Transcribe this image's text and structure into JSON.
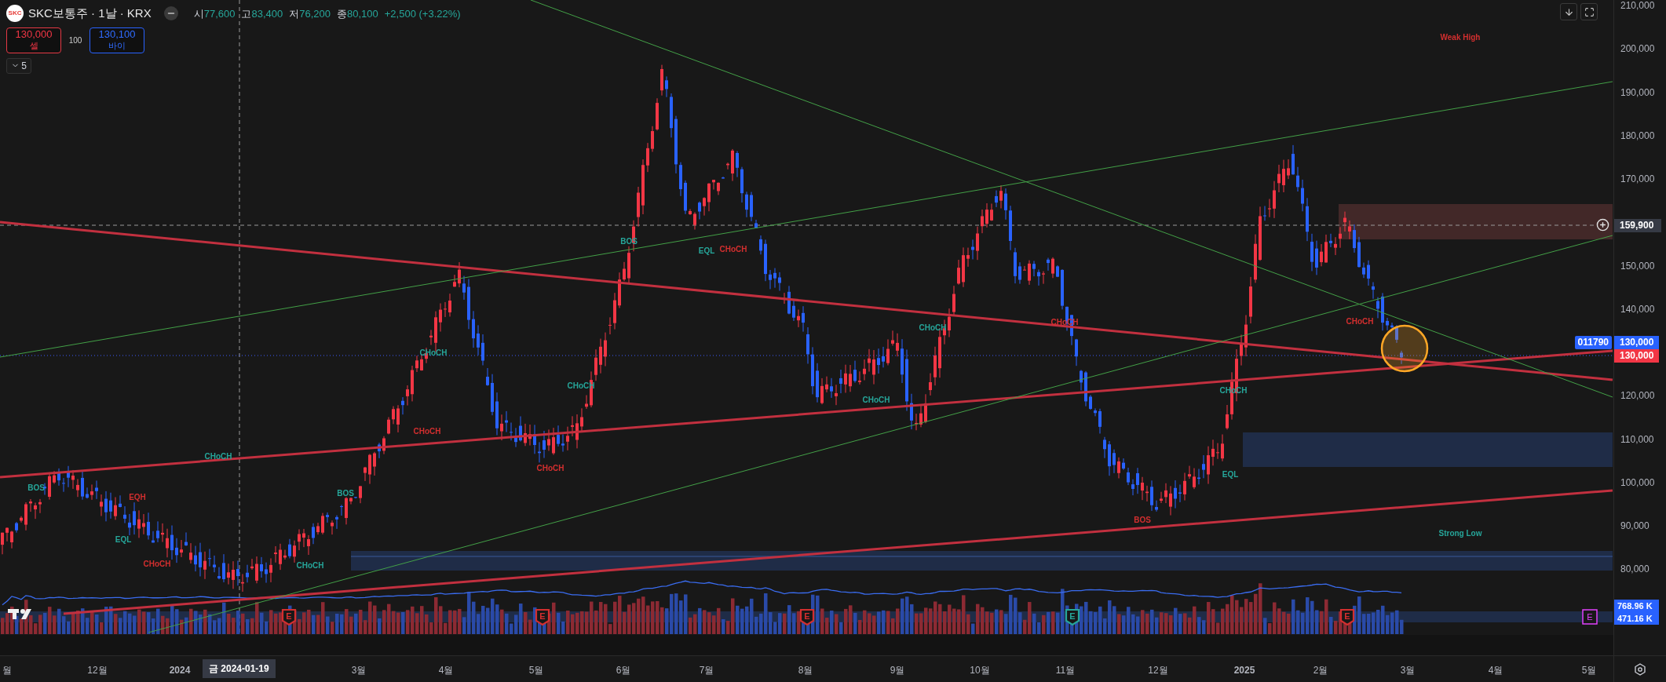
{
  "symbol": {
    "logo": "SKC",
    "title": "SKC보통주 · 1날 · KRX"
  },
  "ohlc": [
    {
      "label": "시",
      "value": "77,600"
    },
    {
      "label": "고",
      "value": "83,400"
    },
    {
      "label": "저",
      "value": "76,200"
    },
    {
      "label": "종",
      "value": "80,100"
    }
  ],
  "change": "+2,500 (+3.22%)",
  "order": {
    "sell_price": "130,000",
    "sell_label": "셀",
    "quantity": "100",
    "buy_price": "130,100",
    "buy_label": "바이"
  },
  "indicators_toggle": {
    "count": "5",
    "expanded": false
  },
  "annotations": [
    {
      "text": "BOS",
      "color": "#26a69a"
    },
    {
      "text": "EQH",
      "color": "#d32f2f"
    },
    {
      "text": "EQL",
      "color": "#26a69a"
    },
    {
      "text": "CHoCH",
      "color": "#d32f2f"
    },
    {
      "text": "CHoCH",
      "color": "#26a69a"
    },
    {
      "text": "BOS",
      "color": "#26a69a"
    },
    {
      "text": "CHoCH",
      "color": "#26a69a"
    },
    {
      "text": "CHoCH",
      "color": "#26a69a"
    },
    {
      "text": "CHoCH",
      "color": "#d32f2f"
    },
    {
      "text": "CHoCH",
      "color": "#26a69a"
    },
    {
      "text": "CHoCH",
      "color": "#d32f2f"
    },
    {
      "text": "BOS",
      "color": "#26a69a"
    },
    {
      "text": "EQL",
      "color": "#26a69a"
    },
    {
      "text": "CHoCH",
      "color": "#d32f2f"
    },
    {
      "text": "CHoCH",
      "color": "#26a69a"
    },
    {
      "text": "CHoCH",
      "color": "#26a69a"
    },
    {
      "text": "CHoCH",
      "color": "#d32f2f"
    },
    {
      "text": "CHoCH",
      "color": "#26a69a"
    },
    {
      "text": "EQL",
      "color": "#26a69a"
    },
    {
      "text": "BOS",
      "color": "#d32f2f"
    },
    {
      "text": "CHoCH",
      "color": "#d32f2f"
    },
    {
      "text": "Weak High",
      "color": "#d32f2f"
    },
    {
      "text": "Strong Low",
      "color": "#26a69a"
    }
  ],
  "events": [
    {
      "letter": "E",
      "color": "#d32f2f"
    },
    {
      "letter": "E",
      "color": "#d32f2f"
    },
    {
      "letter": "E",
      "color": "#d32f2f"
    },
    {
      "letter": "E",
      "color": "#26a69a"
    },
    {
      "letter": "E",
      "color": "#d32f2f"
    },
    {
      "letter": "E",
      "color": "#e040fb"
    }
  ],
  "price_axis": {
    "labels": [
      "210,000",
      "200,000",
      "190,000",
      "180,000",
      "170,000",
      "150,000",
      "140,000",
      "120,000",
      "110,000",
      "100,000",
      "90,000",
      "80,000"
    ],
    "crosshair_price": "159,900",
    "symbol_code": "011790",
    "last_price": "130,000",
    "prev_price": "130,000",
    "volume_ma": "768.96 K",
    "volume": "471.16 K"
  },
  "time_axis": {
    "labels": [
      {
        "text": "월",
        "kind": "month"
      },
      {
        "text": "12월",
        "kind": "month"
      },
      {
        "text": "2024",
        "kind": "year"
      },
      {
        "text": "3월",
        "kind": "month"
      },
      {
        "text": "4월",
        "kind": "month"
      },
      {
        "text": "5월",
        "kind": "month"
      },
      {
        "text": "6월",
        "kind": "month"
      },
      {
        "text": "7월",
        "kind": "month"
      },
      {
        "text": "8월",
        "kind": "month"
      },
      {
        "text": "9월",
        "kind": "month"
      },
      {
        "text": "10월",
        "kind": "month"
      },
      {
        "text": "11월",
        "kind": "month"
      },
      {
        "text": "12월",
        "kind": "month"
      },
      {
        "text": "2025",
        "kind": "year"
      },
      {
        "text": "2월",
        "kind": "month"
      },
      {
        "text": "3월",
        "kind": "month"
      },
      {
        "text": "4월",
        "kind": "month"
      },
      {
        "text": "5월",
        "kind": "month"
      }
    ],
    "crosshair_date": "금 2024-01-19"
  }
}
